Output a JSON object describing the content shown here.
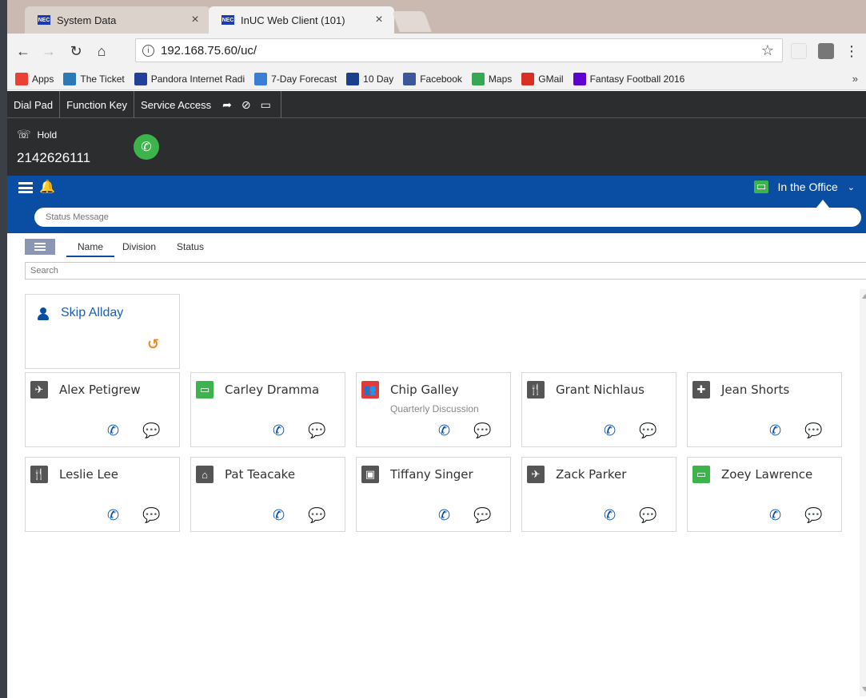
{
  "browser": {
    "tabs": [
      {
        "label": "System Data",
        "favicon": "NEC",
        "active": false
      },
      {
        "label": "InUC Web Client (101)",
        "favicon": "NEC",
        "active": true
      }
    ],
    "close_glyph": "×",
    "url": "192.168.75.60/uc/",
    "bookmarks": [
      {
        "label": "Apps",
        "icon": "apps-grid-icon",
        "color": "#e94235"
      },
      {
        "label": "The Ticket",
        "icon": "ticket-icon",
        "color": "#2a7ab8"
      },
      {
        "label": "Pandora Internet Radi",
        "icon": "pandora-icon",
        "color": "#224099"
      },
      {
        "label": "7-Day Forecast",
        "icon": "weather-icon",
        "color": "#3a7fd5"
      },
      {
        "label": "10 Day",
        "icon": "weather-channel-icon",
        "color": "#1c3f8c"
      },
      {
        "label": "Facebook",
        "icon": "facebook-icon",
        "color": "#3b5998"
      },
      {
        "label": "Maps",
        "icon": "maps-icon",
        "color": "#34a853"
      },
      {
        "label": "GMail",
        "icon": "gmail-icon",
        "color": "#d93025"
      },
      {
        "label": "Fantasy Football 2016",
        "icon": "yahoo-icon",
        "color": "#5f01d1"
      }
    ],
    "bookmarks_more": "»"
  },
  "app": {
    "menu": [
      "Dial Pad",
      "Function Key",
      "Service Access"
    ],
    "call": {
      "state": "Hold",
      "number": "2142626111"
    },
    "presence": {
      "label": "In the Office",
      "color": "#3cb44b"
    },
    "status_placeholder": "Status Message",
    "sort_tabs": [
      "Name",
      "Division",
      "Status"
    ],
    "search_placeholder": "Search",
    "self": {
      "name": "Skip Allday"
    },
    "contacts": [
      {
        "name": "Alex Petigrew",
        "icon": "airplane-icon",
        "glyph": "✈",
        "color": "#555555",
        "note": ""
      },
      {
        "name": "Carley Dramma",
        "icon": "monitor-icon",
        "glyph": "▭",
        "color": "#3cb44b",
        "note": ""
      },
      {
        "name": "Chip Galley",
        "icon": "meeting-icon",
        "glyph": "👥",
        "color": "#e53935",
        "note": "Quarterly Discussion"
      },
      {
        "name": "Grant Nichlaus",
        "icon": "fork-knife-icon",
        "glyph": "🍴",
        "color": "#555555",
        "note": ""
      },
      {
        "name": "Jean Shorts",
        "icon": "medical-icon",
        "glyph": "✚",
        "color": "#555555",
        "note": ""
      },
      {
        "name": "Leslie Lee",
        "icon": "fork-knife-icon",
        "glyph": "🍴",
        "color": "#555555",
        "note": ""
      },
      {
        "name": "Pat Teacake",
        "icon": "home-icon",
        "glyph": "⌂",
        "color": "#555555",
        "note": ""
      },
      {
        "name": "Tiffany Singer",
        "icon": "calendar-icon",
        "glyph": "▣",
        "color": "#555555",
        "note": ""
      },
      {
        "name": "Zack Parker",
        "icon": "airplane-icon",
        "glyph": "✈",
        "color": "#555555",
        "note": ""
      },
      {
        "name": "Zoey Lawrence",
        "icon": "monitor-icon",
        "glyph": "▭",
        "color": "#3cb44b",
        "note": ""
      }
    ]
  }
}
